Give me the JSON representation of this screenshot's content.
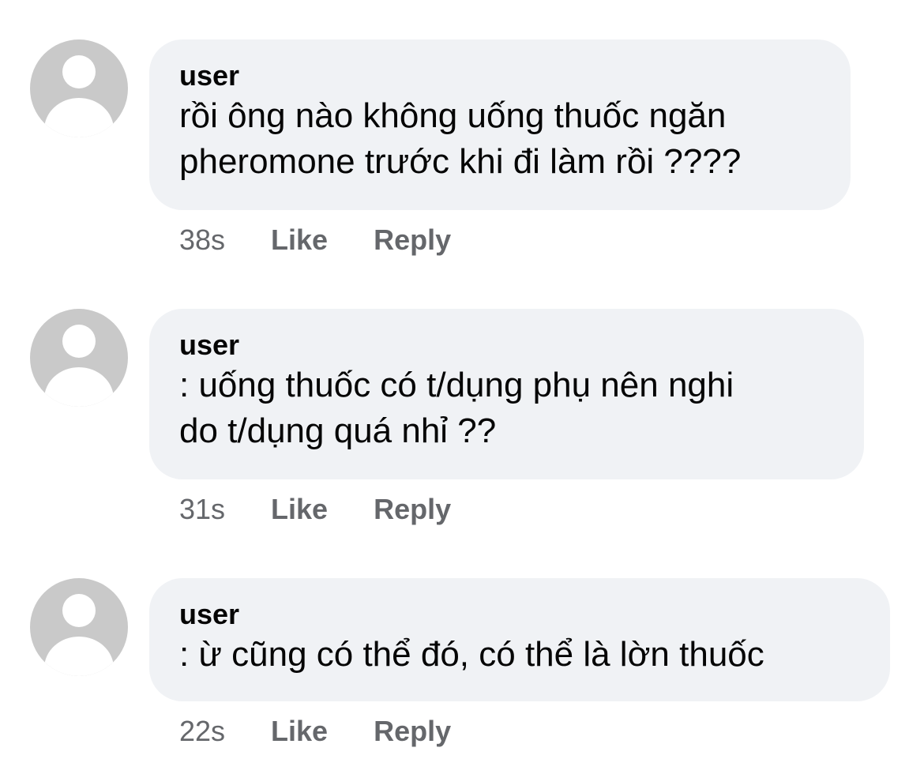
{
  "comments": [
    {
      "author": "user",
      "lines": [
        "rồi ông nào không uống thuốc ngăn",
        "pheromone trước khi đi làm rồi ????"
      ],
      "time": "38s",
      "like_label": "Like",
      "reply_label": "Reply"
    },
    {
      "author": "user",
      "lines": [
        ": uống thuốc có t/dụng phụ nên nghi",
        "do t/dụng quá nhỉ ??"
      ],
      "time": "31s",
      "like_label": "Like",
      "reply_label": "Reply"
    },
    {
      "author": "user",
      "lines": [
        ": ừ cũng có thể đó, có thể là lờn thuốc"
      ],
      "time": "22s",
      "like_label": "Like",
      "reply_label": "Reply"
    }
  ],
  "colors": {
    "bubble": "#f0f2f5",
    "avatar": "#c9c9c9",
    "meta_text": "#65676b",
    "text": "#050505"
  },
  "icons": {
    "avatar": "default-user-avatar-icon"
  }
}
